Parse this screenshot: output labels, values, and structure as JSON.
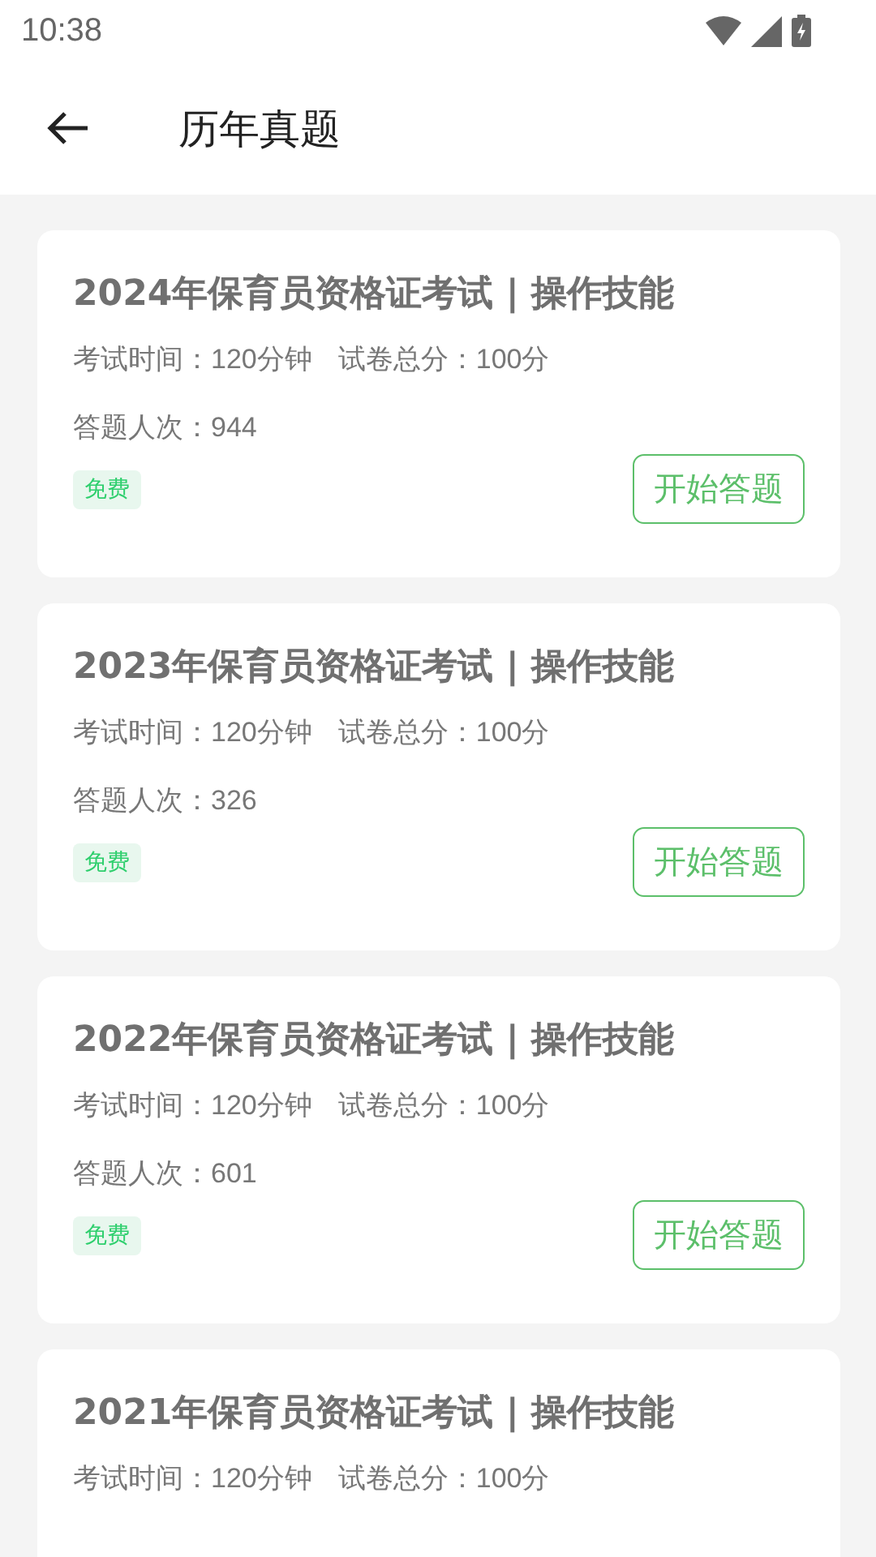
{
  "status_bar": {
    "time": "10:38"
  },
  "header": {
    "title": "历年真题"
  },
  "papers": [
    {
      "title": "2024年保育员资格证考试 | 操作技能",
      "duration": "考试时间：120分钟",
      "total_score": "试卷总分：100分",
      "attempts": "答题人次：944",
      "tag": "免费",
      "button": "开始答题"
    },
    {
      "title": "2023年保育员资格证考试 | 操作技能",
      "duration": "考试时间：120分钟",
      "total_score": "试卷总分：100分",
      "attempts": "答题人次：326",
      "tag": "免费",
      "button": "开始答题"
    },
    {
      "title": "2022年保育员资格证考试 | 操作技能",
      "duration": "考试时间：120分钟",
      "total_score": "试卷总分：100分",
      "attempts": "答题人次：601",
      "tag": "免费",
      "button": "开始答题"
    },
    {
      "title": "2021年保育员资格证考试 | 操作技能",
      "duration": "考试时间：120分钟",
      "total_score": "试卷总分：100分"
    }
  ]
}
